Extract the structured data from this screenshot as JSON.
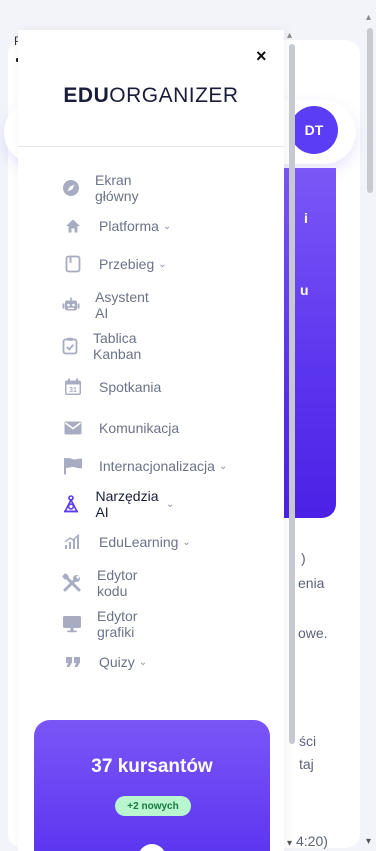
{
  "page": {
    "top_letter": "P",
    "avatar_initials": "DT",
    "hero_fragments": [
      "i",
      "u"
    ],
    "bg_fragments": [
      ")",
      "enia",
      "owe.",
      "ści",
      "taj",
      "4:20)"
    ]
  },
  "drawer": {
    "close_label": "×",
    "brand_bold": "EDU",
    "brand_rest": "ORGANIZER",
    "items": [
      {
        "label": "Ekran główny",
        "chevron": "",
        "icon": "compass-icon"
      },
      {
        "label": "Platforma",
        "chevron": "⌄",
        "icon": "home-icon"
      },
      {
        "label": "Przebieg",
        "chevron": "⌄",
        "icon": "notebook-icon"
      },
      {
        "label": "Asystent AI",
        "chevron": "",
        "icon": "robot-icon"
      },
      {
        "label": "Tablica Kanban",
        "chevron": "",
        "icon": "clipboard-check-icon"
      },
      {
        "label": "Spotkania",
        "chevron": "",
        "icon": "calendar-icon"
      },
      {
        "label": "Komunikacja",
        "chevron": "",
        "icon": "mail-icon"
      },
      {
        "label": "Internacjonalizacja",
        "chevron": "⌄",
        "icon": "flag-icon"
      },
      {
        "label": "Narzędzia AI",
        "chevron": "⌄",
        "icon": "ai-tools-icon"
      },
      {
        "label": "EduLearning",
        "chevron": "⌄",
        "icon": "signal-chart-icon"
      },
      {
        "label": "Edytor kodu",
        "chevron": "",
        "icon": "tools-icon"
      },
      {
        "label": "Edytor grafiki",
        "chevron": "",
        "icon": "monitor-icon"
      },
      {
        "label": "Quizy",
        "chevron": "⌄",
        "icon": "quote-icon"
      }
    ],
    "calendar_day": "31",
    "promo": {
      "title": "37 kursantów",
      "badge": "+2 nowych"
    }
  },
  "colors": {
    "accent": "#5b3df5",
    "menu_icon": "#a8acc2",
    "active_icon": "#5b3df5",
    "badge_bg": "#b9f5cf",
    "badge_text": "#167a3d"
  }
}
